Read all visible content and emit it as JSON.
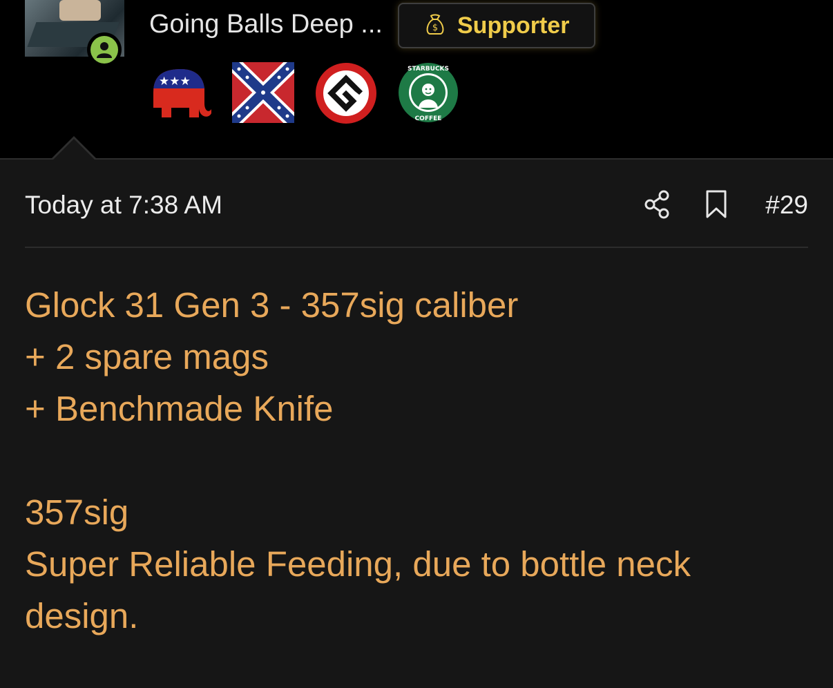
{
  "user": {
    "name": "Going Balls Deep ...",
    "status": "online",
    "supporter_label": "Supporter",
    "badges": [
      "republican-elephant-icon",
      "confederate-flag-icon",
      "grammar-nazi-g-icon",
      "starbucks-coffee-logo-icon"
    ],
    "starbucks_text_top": "STARBUCKS",
    "starbucks_text_bottom": "COFFEE"
  },
  "post": {
    "timestamp": "Today at 7:38 AM",
    "number": "#29",
    "lines": [
      "Glock 31 Gen 3 - 357sig caliber",
      "+ 2 spare mags",
      "+ Benchmade Knife",
      "",
      "357sig",
      "Super Reliable Feeding, due to bottle neck",
      "design."
    ]
  },
  "colors": {
    "background": "#161616",
    "header_bg": "#000000",
    "post_text": "#e8a85a",
    "supporter_text": "#f0cc4a",
    "online": "#8bc34a"
  }
}
